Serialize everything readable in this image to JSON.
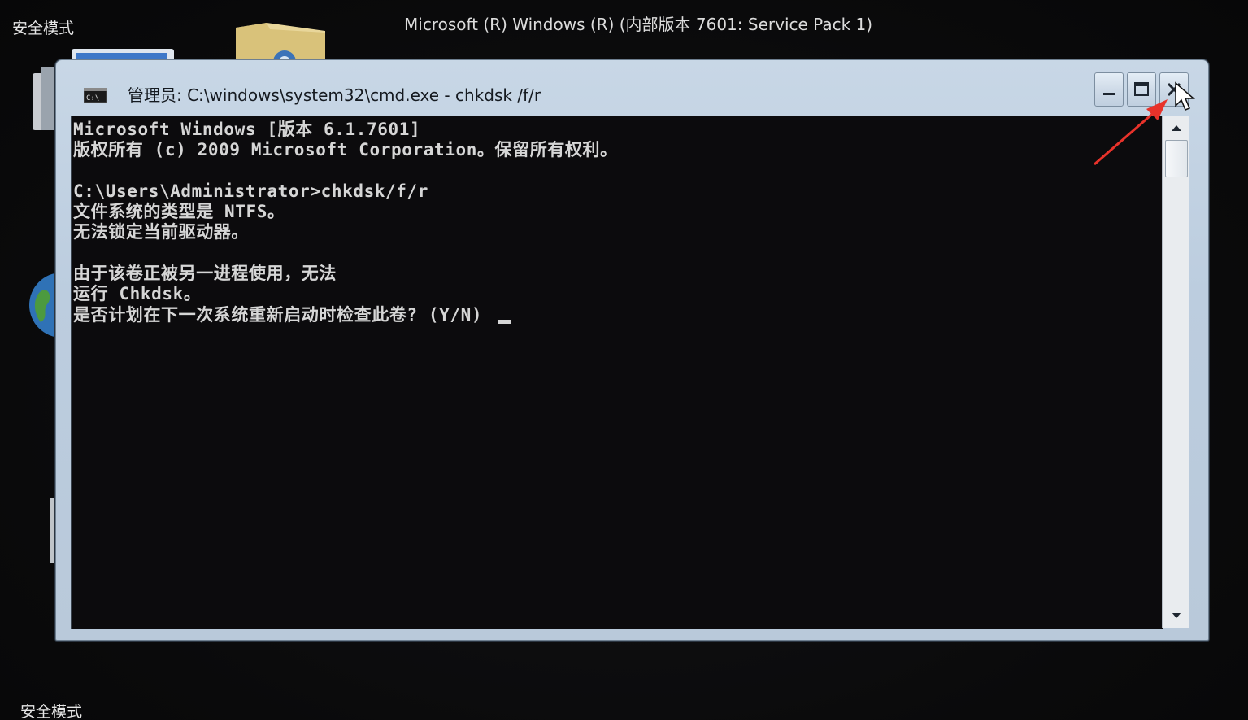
{
  "desktop": {
    "safe_mode_top": "安全模式",
    "safe_mode_bottom": "安全模式",
    "os_banner": "Microsoft (R) Windows (R) (内部版本 7601: Service Pack 1)",
    "icons": [
      "computer-icon",
      "folder-icon",
      "globe-icon",
      "recycle-bin-icon"
    ]
  },
  "window": {
    "title": "管理员: C:\\windows\\system32\\cmd.exe - chkdsk /f/r",
    "app_icon": "console-icon",
    "buttons": {
      "minimize": "minimize-icon",
      "maximize": "maximize-icon",
      "close": "close-icon"
    }
  },
  "console": {
    "lines": [
      "Microsoft Windows [版本 6.1.7601]",
      "版权所有 (c) 2009 Microsoft Corporation。保留所有权利。",
      "",
      "C:\\Users\\Administrator>chkdsk/f/r",
      "文件系统的类型是 NTFS。",
      "无法锁定当前驱动器。",
      "",
      "由于该卷正被另一进程使用，无法",
      "运行 Chkdsk。",
      "是否计划在下一次系统重新启动时检查此卷? (Y/N) "
    ]
  },
  "colors": {
    "console_bg": "#0c0b0d",
    "console_text": "#d6d6d6",
    "window_frame": "#c8d7e6",
    "annotation_arrow": "#e8322a"
  }
}
